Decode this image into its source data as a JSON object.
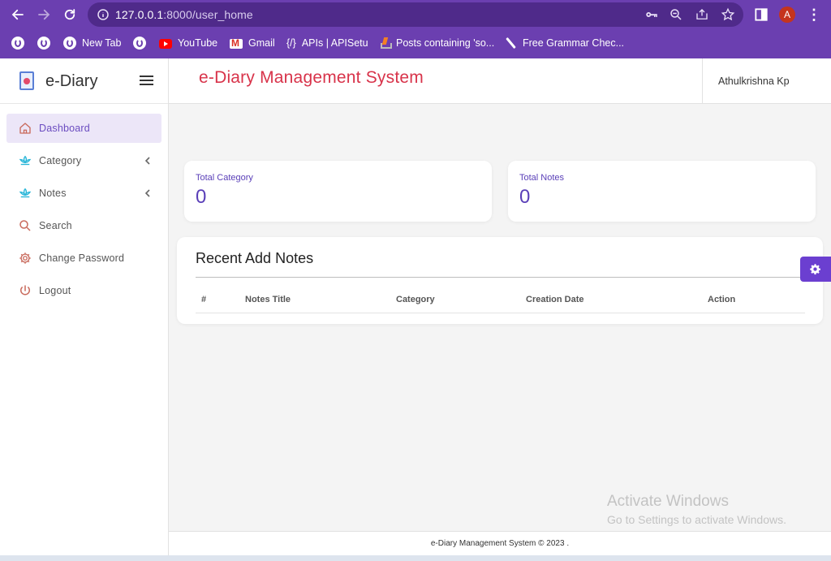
{
  "browser": {
    "url_host": "127.0.0.1",
    "url_path": ":8000/user_home",
    "avatar_letter": "A",
    "bookmarks": [
      {
        "label": "",
        "icon": "globe-icon"
      },
      {
        "label": "",
        "icon": "globe-icon"
      },
      {
        "label": "New Tab",
        "icon": "globe-icon"
      },
      {
        "label": "",
        "icon": "globe-icon"
      },
      {
        "label": "YouTube",
        "icon": "youtube-icon"
      },
      {
        "label": "Gmail",
        "icon": "gmail-icon"
      },
      {
        "label": "APIs | APISetu",
        "icon": "apisetu-icon"
      },
      {
        "label": "Posts containing 'so...",
        "icon": "stackoverflow-icon"
      },
      {
        "label": "Free Grammar Chec...",
        "icon": "pen-icon"
      }
    ]
  },
  "sidebar": {
    "brand": "e-Diary",
    "items": [
      {
        "label": "Dashboard",
        "icon": "home-icon",
        "active": true
      },
      {
        "label": "Category",
        "icon": "lotus-icon",
        "has_submenu": true
      },
      {
        "label": "Notes",
        "icon": "lotus-icon",
        "has_submenu": true
      },
      {
        "label": "Search",
        "icon": "search-icon"
      },
      {
        "label": "Change Password",
        "icon": "gear-icon"
      },
      {
        "label": "Logout",
        "icon": "power-icon"
      }
    ]
  },
  "header": {
    "title": "e-Diary Management System",
    "user": "Athulkrishna Kp"
  },
  "stats": [
    {
      "label": "Total Category",
      "value": "0"
    },
    {
      "label": "Total Notes",
      "value": "0"
    }
  ],
  "recent": {
    "title": "Recent Add Notes",
    "columns": [
      "#",
      "Notes Title",
      "Category",
      "Creation Date",
      "Action"
    ]
  },
  "watermark": {
    "line1": "Activate Windows",
    "line2": "Go to Settings to activate Windows."
  },
  "footer": {
    "text": "e-Diary Management System © 2023 ."
  },
  "colors": {
    "chrome": "#6b3fb0",
    "accent": "#5a3fb8",
    "title": "#d8334a",
    "settings_tab": "#6b3fd0"
  }
}
